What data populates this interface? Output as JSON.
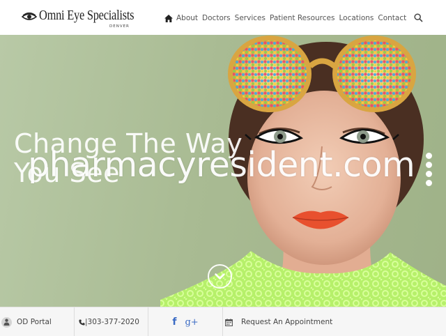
{
  "header": {
    "logo": {
      "name": "Omni Eye Specialists",
      "subtitle": "DENVER"
    },
    "nav": {
      "home_icon": "home-icon",
      "items": [
        {
          "label": "About"
        },
        {
          "label": "Doctors"
        },
        {
          "label": "Services"
        },
        {
          "label": "Patient Resources"
        },
        {
          "label": "Locations"
        },
        {
          "label": "Contact"
        }
      ],
      "search_icon": "search-icon"
    }
  },
  "hero": {
    "headline_line1": "Change The Way",
    "headline_line2": "You See",
    "watermark": "pharmacyresident.com",
    "slider": {
      "dot_count": 4,
      "active_index": 0
    },
    "scroll_icon": "chevron-down-circle-icon"
  },
  "bottom_bar": {
    "od_portal": {
      "label": "OD Portal",
      "icon": "user-tie-icon"
    },
    "phone": {
      "label": "|303-377-2020",
      "icon": "phone-icon"
    },
    "social": {
      "facebook": "f",
      "google_plus": "g+"
    },
    "appointment": {
      "label": "Request An Appointment",
      "icon": "calendar-icon"
    }
  },
  "colors": {
    "hero_bg": "#a9bb93",
    "social_blue": "#3b6bc4",
    "nav_text": "#555555"
  }
}
